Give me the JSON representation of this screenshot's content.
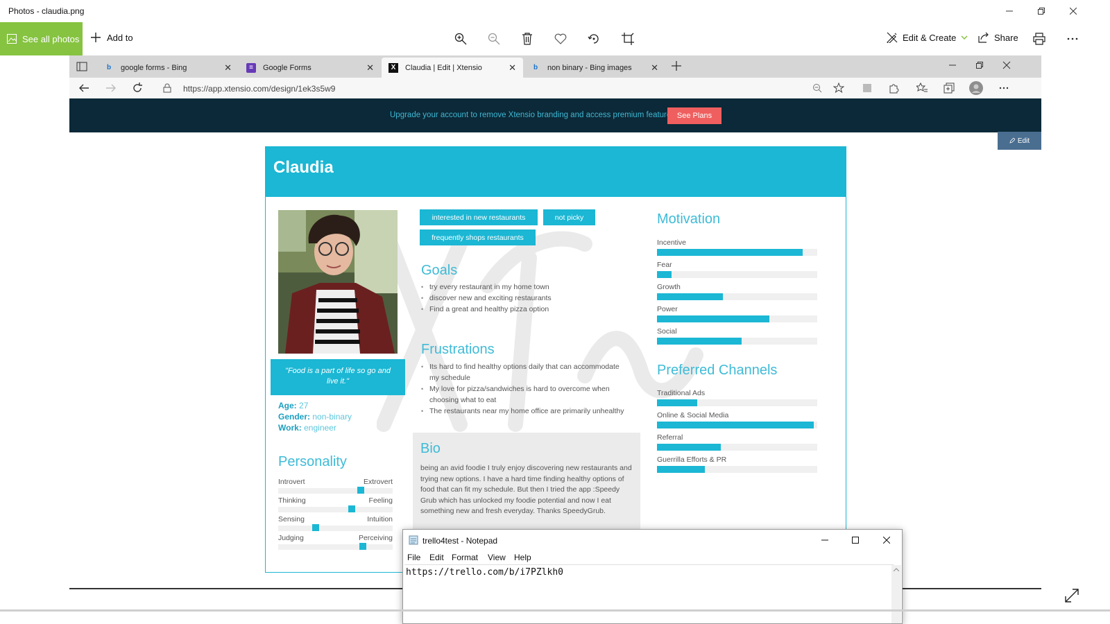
{
  "window": {
    "title": "Photos - claudia.png"
  },
  "photos_toolbar": {
    "see_all": "See all photos",
    "add_to": "Add to",
    "edit_create": "Edit & Create",
    "share": "Share",
    "icons": [
      "zoom-in-icon",
      "zoom-out-icon",
      "delete-icon",
      "favorite-icon",
      "rotate-icon",
      "crop-icon",
      "print-icon",
      "more-icon"
    ]
  },
  "browser": {
    "tabs": [
      {
        "title": "google forms - Bing",
        "icon": "bing-icon"
      },
      {
        "title": "Google Forms",
        "icon": "google-forms-icon"
      },
      {
        "title": "Claudia | Edit | Xtensio",
        "icon": "xtensio-icon",
        "active": true
      },
      {
        "title": "non binary - Bing images",
        "icon": "bing-icon"
      }
    ],
    "url": "https://app.xtensio.com/design/1ek3s5w9"
  },
  "banner": {
    "message": "Upgrade your account to remove Xtensio branding and access premium features.",
    "cta": "See Plans"
  },
  "edit_button": "Edit",
  "persona": {
    "name": "Claudia",
    "quote": "\"Food is a part of life so go and live it.\"",
    "age_label": "Age:",
    "age": "27",
    "gender_label": "Gender:",
    "gender": "non-binary",
    "work_label": "Work:",
    "work": "engineer",
    "personality_title": "Personality",
    "personality": [
      {
        "left": "Introvert",
        "right": "Extrovert",
        "value": 0.72
      },
      {
        "left": "Thinking",
        "right": "Feeling",
        "value": 0.64
      },
      {
        "left": "Sensing",
        "right": "Intuition",
        "value": 0.33
      },
      {
        "left": "Judging",
        "right": "Perceiving",
        "value": 0.74
      }
    ],
    "tags": [
      "interested in new restaurants",
      "not picky",
      "frequently shops restaurants"
    ],
    "goals_title": "Goals",
    "goals": [
      "try every restaurant in my home town",
      "discover new and exciting restaurants",
      "Find a great and healthy pizza option"
    ],
    "frustrations_title": "Frustrations",
    "frustrations": [
      "Its hard to find healthy options daily that can accommodate my schedule",
      "My love for pizza/sandwiches is hard to overcome when choosing what to eat",
      "The restaurants near my home office are primarily unhealthy"
    ],
    "bio_title": "Bio",
    "bio": "being an avid foodie I truly enjoy discovering new restaurants and trying new options. I have a hard time finding healthy options of food that can fit my schedule. But then I tried the app :Speedy Grub which has unlocked my foodie potential and now I eat something new and fresh everyday. Thanks SpeedyGrub.",
    "motivation_title": "Motivation",
    "motivation": [
      {
        "label": "Incentive",
        "value": 0.91
      },
      {
        "label": "Fear",
        "value": 0.09
      },
      {
        "label": "Growth",
        "value": 0.41
      },
      {
        "label": "Power",
        "value": 0.7
      },
      {
        "label": "Social",
        "value": 0.53
      }
    ],
    "channels_title": "Preferred Channels",
    "channels": [
      {
        "label": "Traditional Ads",
        "value": 0.25
      },
      {
        "label": "Online & Social Media",
        "value": 0.98
      },
      {
        "label": "Referral",
        "value": 0.4
      },
      {
        "label": "Guerrilla Efforts & PR",
        "value": 0.3
      }
    ]
  },
  "notepad": {
    "title": "trello4test - Notepad",
    "menu": [
      "File",
      "Edit",
      "Format",
      "View",
      "Help"
    ],
    "content": "https://trello.com/b/i7PZlkh0"
  },
  "colors": {
    "accent": "#1bb7d4",
    "photos_green": "#86c341",
    "banner_bg": "#0b2938",
    "cta": "#ef5f5f"
  }
}
